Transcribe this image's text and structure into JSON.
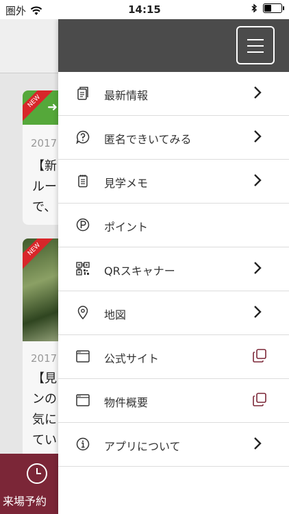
{
  "status": {
    "carrier": "圏外",
    "time": "14:15"
  },
  "background": {
    "cards": [
      {
        "badge": "NEW",
        "date": "2017",
        "text": "【新\nルー\nで、"
      },
      {
        "badge": "NEW",
        "date": "2017",
        "text": "【見\nンの\n気に\nてい"
      }
    ],
    "bottom_tab_label": "来場予約"
  },
  "menu": {
    "items": [
      {
        "label": "最新情報",
        "icon": "news-icon",
        "action": "chevron"
      },
      {
        "label": "匿名できいてみる",
        "icon": "question-icon",
        "action": "chevron"
      },
      {
        "label": "見学メモ",
        "icon": "memo-icon",
        "action": "chevron"
      },
      {
        "label": "ポイント",
        "icon": "point-icon",
        "action": "none"
      },
      {
        "label": "QRスキャナー",
        "icon": "qr-icon",
        "action": "chevron"
      },
      {
        "label": "地図",
        "icon": "map-pin-icon",
        "action": "chevron"
      },
      {
        "label": "公式サイト",
        "icon": "browser-window-icon",
        "action": "external"
      },
      {
        "label": "物件概要",
        "icon": "browser-window-icon",
        "action": "external"
      },
      {
        "label": "アプリについて",
        "icon": "info-icon",
        "action": "chevron"
      }
    ]
  },
  "colors": {
    "header": "#4b4b4b",
    "accent": "#7b2637",
    "badge": "#d8262a"
  }
}
